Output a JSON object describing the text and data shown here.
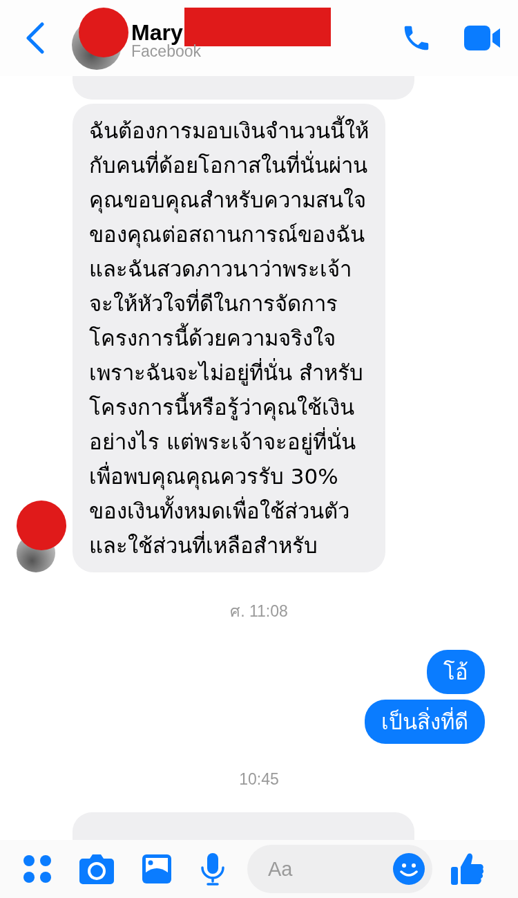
{
  "header": {
    "contact_name": "Mary",
    "name_redacted": true,
    "avatar_redacted": true,
    "subtitle": "Facebook"
  },
  "messages": [
    {
      "kind": "partial_top"
    },
    {
      "kind": "received",
      "avatar_redacted": true,
      "lines": [
        "ฉันต้องการมอบเงินจำนวนนี้ให้",
        "กับคนที่ด้อยโอกาสในที่นั่นผ่าน",
        "คุณขอบคุณสำหรับความสนใจ",
        "ของคุณต่อสถานการณ์ของฉัน",
        "และฉันสวดภาวนาว่าพระเจ้า",
        "จะให้หัวใจที่ดีในการจัดการ",
        "โครงการนี้ด้วยความจริงใจ",
        "เพราะฉันจะไม่อยู่ที่นั่น สำหรับ",
        "โครงการนี้หรือรู้ว่าคุณใช้เงิน",
        "อย่างไร แต่พระเจ้าจะอยู่ที่นั่น",
        "เพื่อพบคุณคุณควรรับ 30%",
        "ของเงินทั้งหมดเพื่อใช้ส่วนตัว",
        "และใช้ส่วนที่เหลือสำหรับ"
      ]
    },
    {
      "kind": "timestamp",
      "text": "ศ. 11:08"
    },
    {
      "kind": "sent",
      "lines": [
        "โอ้"
      ]
    },
    {
      "kind": "sent",
      "lines": [
        "เป็นสิ่งที่ดี"
      ]
    },
    {
      "kind": "timestamp",
      "text": "10:45"
    },
    {
      "kind": "partial_bottom"
    }
  ],
  "composer": {
    "placeholder": "Aa"
  }
}
